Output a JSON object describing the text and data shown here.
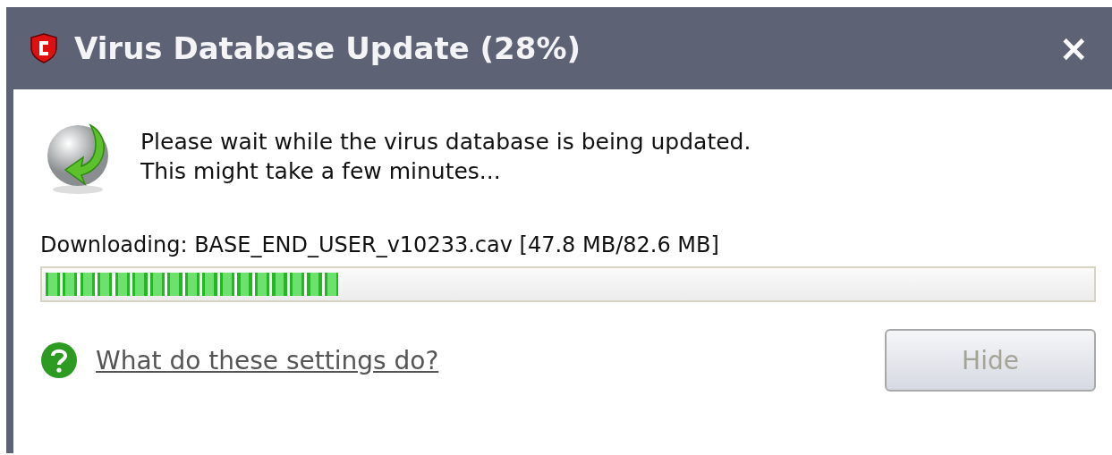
{
  "window": {
    "title": "Virus Database Update (28%)",
    "close": "×"
  },
  "message": {
    "lines": [
      "Please wait while the virus database is being updated.",
      "This might take a few minutes..."
    ]
  },
  "download": {
    "label": "Downloading: BASE_END_USER_v10233.cav [47.8 MB/82.6 MB]",
    "level": 0.28
  },
  "help_link": "What do these settings do?",
  "buttons": [
    {
      "label": "Hide",
      "disabled": true
    }
  ]
}
